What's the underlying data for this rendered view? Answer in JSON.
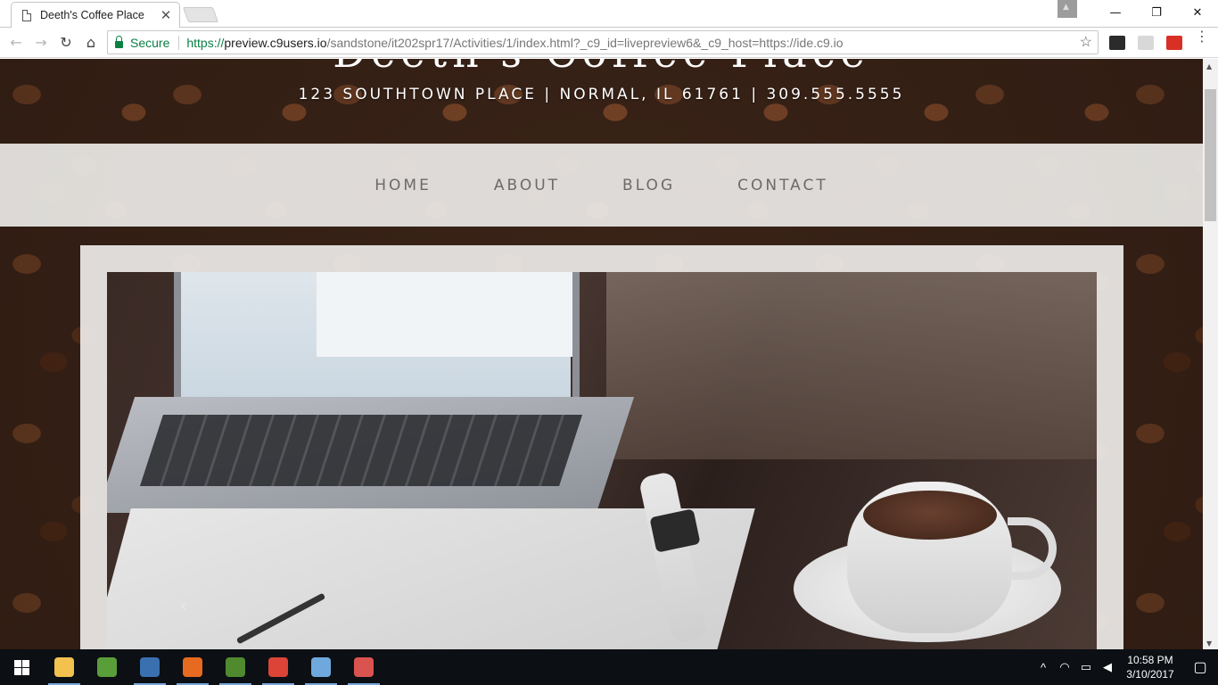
{
  "browser": {
    "tab_title": "Deeth's Coffee Place",
    "tab_close": "✕",
    "secure_label": "Secure",
    "url_scheme": "https://",
    "url_host": "preview.c9users.io",
    "url_path": "/sandstone/it202spr17/Activities/1/index.html?_c9_id=livepreview6&_c9_host=https://ide.c9.io",
    "minimize": "—",
    "restore": "❐",
    "close": "✕",
    "back": "←",
    "forward": "→",
    "reload": "↻",
    "home": "⌂",
    "star": "☆",
    "menu": "⋮"
  },
  "site": {
    "title": "Deeth's Coffee Place",
    "address": "123 SOUTHTOWN PLACE | NORMAL, IL 61761 | 309.555.5555",
    "nav": [
      "HOME",
      "ABOUT",
      "BLOG",
      "CONTACT"
    ],
    "carousel": {
      "prev": "‹",
      "next": "›"
    }
  },
  "taskbar": {
    "apps": [
      {
        "name": "file-explorer",
        "color": "#f2c14e",
        "open": true
      },
      {
        "name": "windows-media-icon",
        "color": "#5a9e3a",
        "open": false
      },
      {
        "name": "thunderbird",
        "color": "#3a6fb0",
        "open": true
      },
      {
        "name": "firefox",
        "color": "#e66a1f",
        "open": true
      },
      {
        "name": "vmware",
        "color": "#4f8a2e",
        "open": true
      },
      {
        "name": "chrome",
        "color": "#db4437",
        "open": true
      },
      {
        "name": "virtualbox",
        "color": "#6fa8dc",
        "open": true
      },
      {
        "name": "git",
        "color": "#d9534f",
        "open": true
      }
    ],
    "time": "10:58 PM",
    "date": "3/10/2017"
  }
}
